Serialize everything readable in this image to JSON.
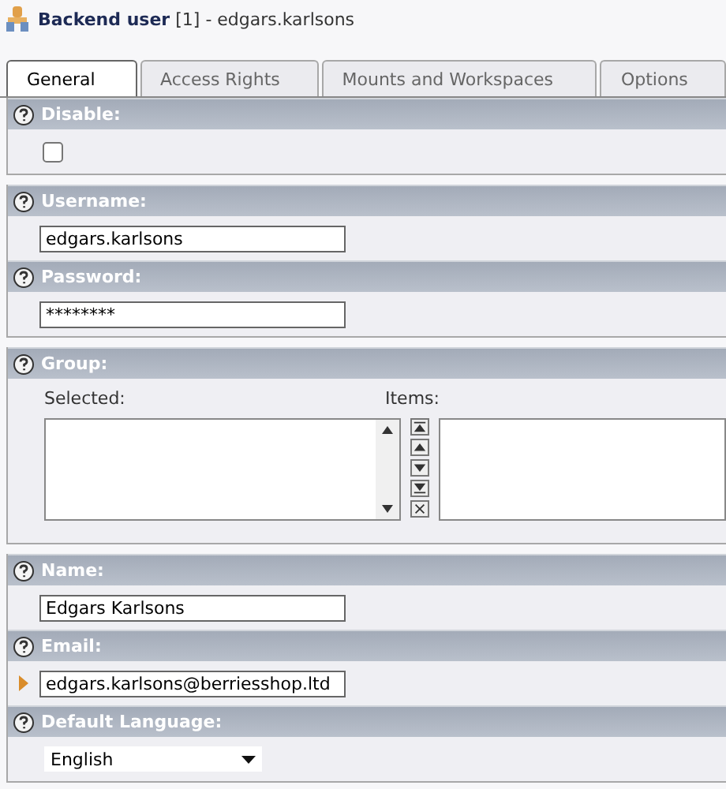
{
  "title": {
    "label": "Backend user",
    "suffix": "[1] - edgars.karlsons"
  },
  "tabs": [
    {
      "label": "General",
      "selected": true
    },
    {
      "label": "Access Rights",
      "selected": false
    },
    {
      "label": "Mounts and Workspaces",
      "selected": false
    },
    {
      "label": "Options",
      "selected": false
    }
  ],
  "sections": [
    {
      "fields": [
        {
          "kind": "checkbox",
          "label": "Disable:",
          "checked": false,
          "modified": false
        }
      ]
    },
    {
      "fields": [
        {
          "kind": "text",
          "label": "Username:",
          "value": "edgars.karlsons",
          "modified": false
        },
        {
          "kind": "text",
          "label": "Password:",
          "value": "********",
          "modified": false
        }
      ]
    },
    {
      "fields": [
        {
          "kind": "group",
          "label": "Group:",
          "selected_label": "Selected:",
          "items_label": "Items:",
          "modified": false
        }
      ]
    },
    {
      "fields": [
        {
          "kind": "text",
          "label": "Name:",
          "value": "Edgars Karlsons",
          "modified": false
        },
        {
          "kind": "text",
          "label": "Email:",
          "value": "edgars.karlsons@berriesshop.ltd",
          "modified": true
        },
        {
          "kind": "select",
          "label": "Default Language:",
          "value": "English",
          "modified": false
        }
      ]
    }
  ]
}
